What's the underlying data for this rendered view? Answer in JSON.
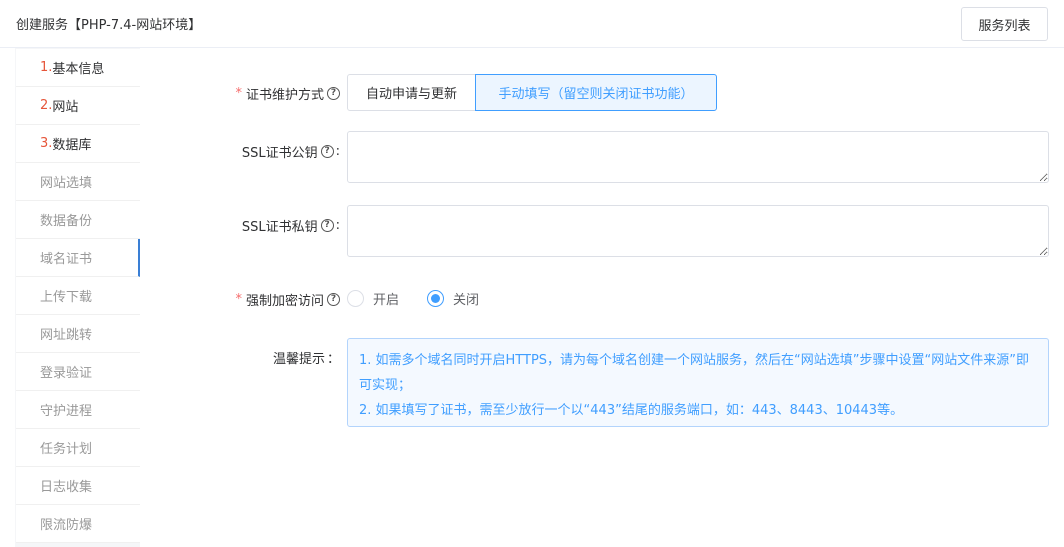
{
  "header": {
    "title": "创建服务【PHP-7.4-网站环境】",
    "service_list_button": "服务列表"
  },
  "sidebar": {
    "items": [
      {
        "num": "1.",
        "label": "基本信息"
      },
      {
        "num": "2.",
        "label": "网站"
      },
      {
        "num": "3.",
        "label": "数据库"
      },
      {
        "num": "",
        "label": "网站选填"
      },
      {
        "num": "",
        "label": "数据备份"
      },
      {
        "num": "",
        "label": "域名证书"
      },
      {
        "num": "",
        "label": "上传下载"
      },
      {
        "num": "",
        "label": "网址跳转"
      },
      {
        "num": "",
        "label": "登录验证"
      },
      {
        "num": "",
        "label": "守护进程"
      },
      {
        "num": "",
        "label": "任务计划"
      },
      {
        "num": "",
        "label": "日志收集"
      },
      {
        "num": "",
        "label": "限流防爆"
      }
    ],
    "active_index": 5
  },
  "form": {
    "cert_mode_label": "证书维护方式",
    "cert_mode_options": [
      "自动申请与更新",
      "手动填写（留空则关闭证书功能）"
    ],
    "cert_mode_selected": 1,
    "ssl_public_label": "SSL证书公钥",
    "ssl_public_value": "",
    "ssl_private_label": "SSL证书私钥",
    "ssl_private_value": "",
    "force_https_label": "强制加密访问",
    "force_https_options": [
      "开启",
      "关闭"
    ],
    "force_https_selected": 1,
    "tip_label": "温馨提示",
    "tip_lines": [
      "1. 如需多个域名同时开启HTTPS，请为每个域名创建一个网站服务，然后在“网站选填”步骤中设置“网站文件来源”即可实现；",
      "2. 如果填写了证书，需至少放行一个以“443”结尾的服务端口，如：443、8443、10443等。"
    ]
  },
  "colors": {
    "accent": "#409eff",
    "required": "#f56c6c",
    "step_number": "#e6553a"
  }
}
